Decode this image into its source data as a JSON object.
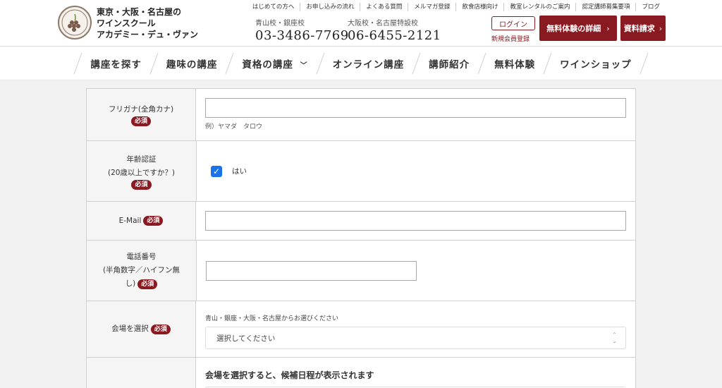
{
  "header": {
    "brand_lines": [
      "東京・大阪・名古屋の",
      "ワインスクール",
      "アカデミー・デュ・ヴァン"
    ],
    "top_links": [
      "はじめての方へ",
      "お申し込みの流れ",
      "よくある質問",
      "メルマガ登録",
      "飲食店様向け",
      "教室レンタルのご案内",
      "認定講師募集要項",
      "ブログ"
    ],
    "phones": [
      {
        "location": "青山校・銀座校",
        "number": "03-3486-7769"
      },
      {
        "location": "大阪校・名古屋特設校",
        "number": "06-6455-2121"
      }
    ],
    "login_label": "ログイン",
    "register_label": "新規会員登録",
    "trial_button": "無料体験の詳細",
    "brochure_button": "資料請求",
    "arrow": "›"
  },
  "nav": {
    "items": [
      "講座を探す",
      "趣味の講座",
      "資格の講座",
      "オンライン講座",
      "講師紹介",
      "無料体験",
      "ワインショップ"
    ],
    "dropdown_marker": "﹀"
  },
  "form": {
    "required_badge": "必須",
    "furigana": {
      "label": "フリガナ(全角カナ)",
      "example": "例）ヤマダ　タロウ"
    },
    "age": {
      "label_line1": "年齢認証",
      "label_line2": "(20歳以上ですか？)",
      "checkbox_label": "はい",
      "checked": true
    },
    "email": {
      "label": "E-Mail"
    },
    "phone": {
      "label_line1": "電話番号",
      "label_line2": "(半角数字／ハイフン無",
      "label_line3": "し)"
    },
    "venue": {
      "label": "会場を選択",
      "hint": "青山・銀座・大阪・名古屋からお選びください",
      "selected": "選択してください"
    },
    "schedule_notice": "会場を選択すると、候補日程が表示されます"
  },
  "colors": {
    "brand_red": "#8a1a22",
    "check_blue": "#1a73e8"
  }
}
